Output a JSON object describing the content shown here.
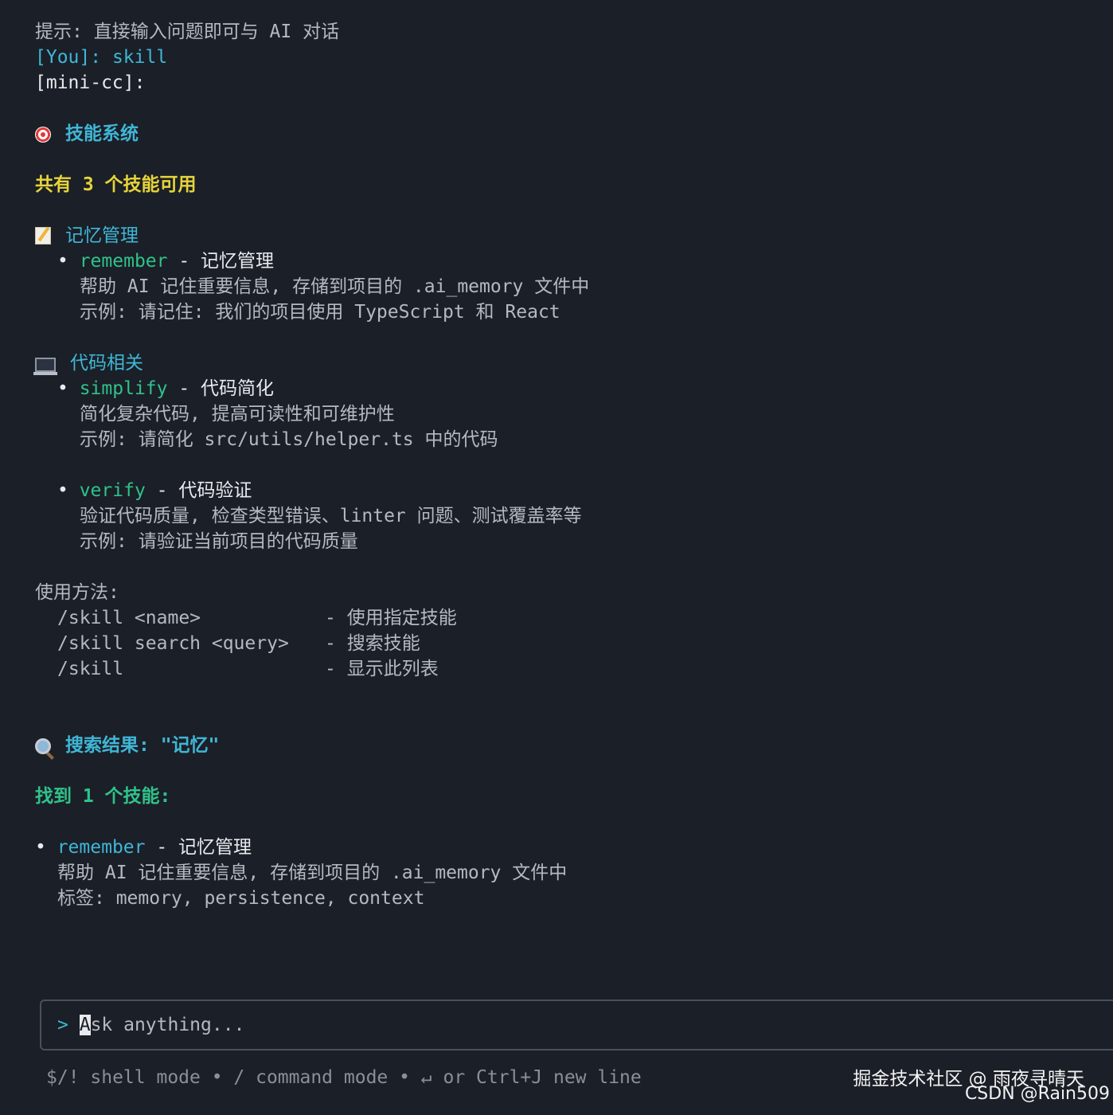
{
  "hint": "提示: 直接输入问题即可与 AI 对话",
  "user_prefix": "[You]: ",
  "user_command": "skill",
  "assistant_prefix": "[mini-cc]:",
  "skills_title": "技能系统",
  "skills_count": "共有 3 个技能可用",
  "categories": [
    {
      "icon": "memo-icon",
      "title": "记忆管理",
      "skills": [
        {
          "name": "remember",
          "desc": " - 记忆管理",
          "detail": "帮助 AI 记住重要信息, 存储到项目的 .ai_memory 文件中",
          "example": "示例: 请记住: 我们的项目使用 TypeScript 和 React"
        }
      ]
    },
    {
      "icon": "laptop-icon",
      "title": "代码相关",
      "skills": [
        {
          "name": "simplify",
          "desc": " - 代码简化",
          "detail": "简化复杂代码, 提高可读性和可维护性",
          "example": "示例: 请简化 src/utils/helper.ts 中的代码"
        },
        {
          "name": "verify",
          "desc": " - 代码验证",
          "detail": "验证代码质量, 检查类型错误、linter 问题、测试覆盖率等",
          "example": "示例: 请验证当前项目的代码质量"
        }
      ]
    }
  ],
  "usage_title": "使用方法:",
  "usage": [
    {
      "cmd": "/skill <name>",
      "desc": "- 使用指定技能"
    },
    {
      "cmd": "/skill search <query>",
      "desc": "- 搜索技能"
    },
    {
      "cmd": "/skill",
      "desc": "- 显示此列表"
    }
  ],
  "search_title": "搜索结果: \"记忆\"",
  "search_count": "找到 1 个技能:",
  "search_result": {
    "name": "remember",
    "desc": " - 记忆管理",
    "detail": "帮助 AI 记住重要信息, 存储到项目的 .ai_memory 文件中",
    "tags": "标签: memory, persistence, context"
  },
  "input": {
    "prompt": "> ",
    "cursor_char": "A",
    "placeholder_rest": "sk anything..."
  },
  "footer": "$/! shell mode • / command mode • ↵ or Ctrl+J new line",
  "watermark_line1": "掘金技术社区 @ 雨夜寻晴天",
  "watermark_line2": "CSDN @Rain509",
  "colors": {
    "background": "#1b1f27",
    "cyan": "#3fb6d6",
    "green": "#2fc28a",
    "yellow": "#e6d43a"
  }
}
